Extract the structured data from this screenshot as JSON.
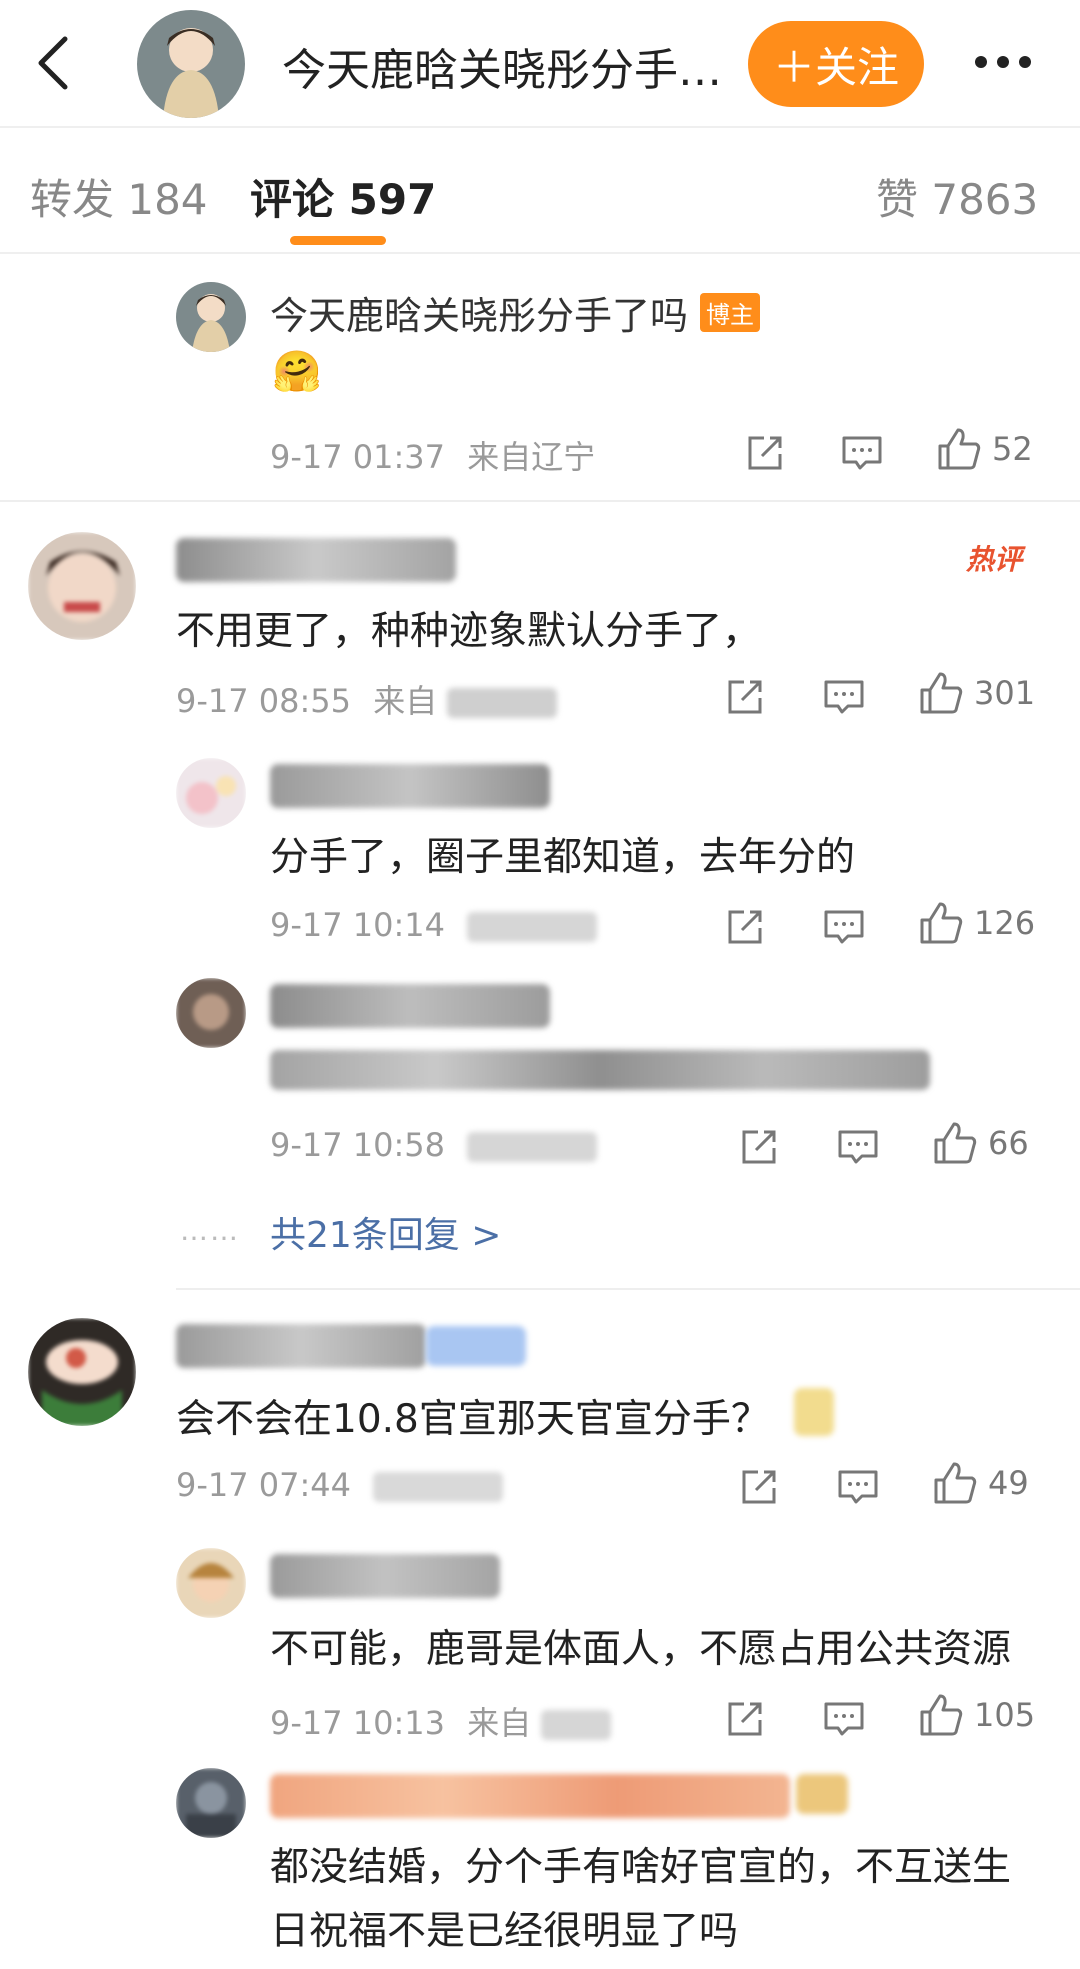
{
  "header": {
    "title": "今天鹿晗关晓彤分手…",
    "follow_label": "＋关注"
  },
  "tabs": [
    {
      "label": "转发 184"
    },
    {
      "label": "评论 597"
    },
    {
      "label": "赞 7863"
    }
  ],
  "comments": [
    {
      "name": "今天鹿晗关晓彤分手了吗",
      "badge": "博主",
      "text": "🤗",
      "time": "9-17 01:37",
      "from": "来自辽宁",
      "likes": "52"
    },
    {
      "tag": "热评",
      "text": "不用更了，种种迹象默认分手了，",
      "time": "9-17 08:55",
      "from": "来自",
      "likes": "301",
      "replies": [
        {
          "text": "分手了，圈子里都知道，去年分的",
          "time": "9-17 10:14",
          "from": "",
          "likes": "126"
        },
        {
          "text": "",
          "time": "9-17 10:58",
          "from": "",
          "likes": "66"
        }
      ],
      "more_replies": "共21条回复 >",
      "dots": "……"
    },
    {
      "text": "会不会在10.8官宣那天官宣分手？",
      "time": "9-17 07:44",
      "from": "",
      "likes": "49",
      "replies": [
        {
          "text": "不可能，鹿哥是体面人，不愿占用公共资源",
          "time": "9-17 10:13",
          "from": "来自",
          "likes": "105"
        },
        {
          "text_line1": "都没结婚，分个手有啥好官宣的，不互送生",
          "text_line2": "日祝福不是已经很明显了吗"
        }
      ]
    }
  ],
  "colors": {
    "accent": "#ff8d1a",
    "link": "#4b6fa6",
    "hot": "#e8532f"
  }
}
